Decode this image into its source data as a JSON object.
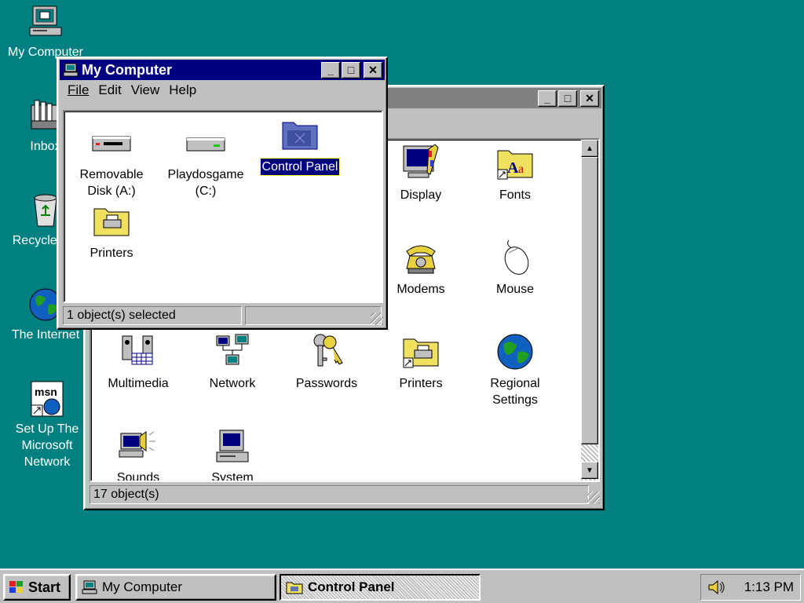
{
  "desktop": {
    "icons": [
      {
        "label": "My Computer",
        "icon": "my-computer-icon"
      },
      {
        "label": "Inbox",
        "icon": "inbox-icon"
      },
      {
        "label": "Recycle Bin",
        "icon": "recycle-bin-icon"
      },
      {
        "label": "The Internet",
        "icon": "internet-icon"
      },
      {
        "label": "Set Up The Microsoft Network",
        "icon": "msn-icon"
      }
    ]
  },
  "control_panel": {
    "title": "Control Panel",
    "items": [
      {
        "label": "Display",
        "icon": "display-icon"
      },
      {
        "label": "Fonts",
        "icon": "fonts-folder-icon"
      },
      {
        "label": "Modems",
        "icon": "modem-phone-icon"
      },
      {
        "label": "Mouse",
        "icon": "mouse-icon"
      },
      {
        "label": "Multimedia",
        "icon": "multimedia-icon"
      },
      {
        "label": "Network",
        "icon": "network-icon"
      },
      {
        "label": "Passwords",
        "icon": "keys-icon"
      },
      {
        "label": "Printers",
        "icon": "printers-folder-icon"
      },
      {
        "label": "Regional Settings",
        "icon": "globe-icon"
      },
      {
        "label": "Sounds",
        "icon": "speaker-icon"
      },
      {
        "label": "System",
        "icon": "system-computer-icon"
      }
    ],
    "status": "17 object(s)"
  },
  "my_computer": {
    "title": "My Computer",
    "menu": [
      "File",
      "Edit",
      "View",
      "Help"
    ],
    "items": [
      {
        "label": "Removable Disk (A:)",
        "icon": "floppy-drive-icon"
      },
      {
        "label": "Playdosgame (C:)",
        "icon": "hard-drive-icon"
      },
      {
        "label": "Control Panel",
        "icon": "control-panel-folder-icon",
        "selected": true
      },
      {
        "label": "Printers",
        "icon": "printers-folder-icon"
      }
    ],
    "status": "1 object(s) selected"
  },
  "taskbar": {
    "start_label": "Start",
    "tasks": [
      {
        "label": "My Computer",
        "active": false
      },
      {
        "label": "Control Panel",
        "active": true
      }
    ],
    "clock": "1:13 PM",
    "tray_icon": "volume-speaker-icon"
  },
  "colors": {
    "desktop": "#008080",
    "active_title": "#000080",
    "inactive_title": "#808080",
    "face": "#c0c0c0"
  }
}
